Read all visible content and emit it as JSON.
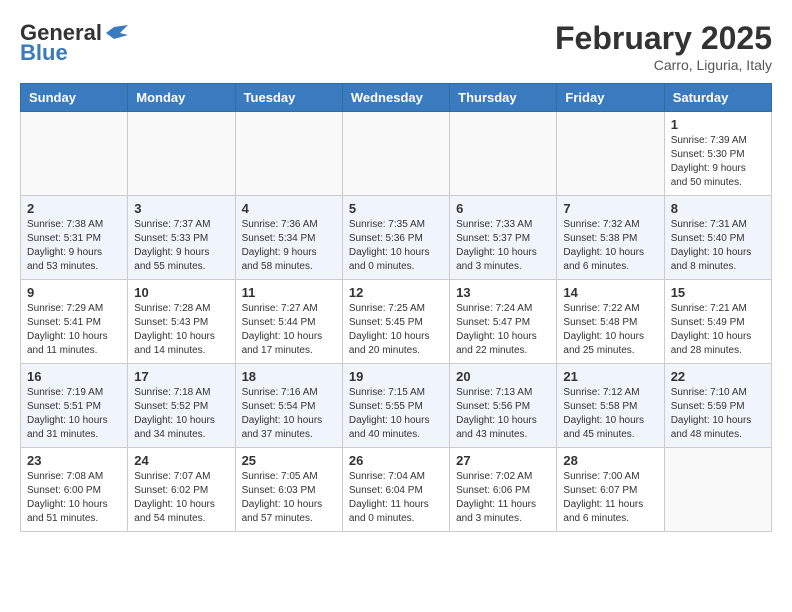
{
  "header": {
    "logo_general": "General",
    "logo_blue": "Blue",
    "month_title": "February 2025",
    "location": "Carro, Liguria, Italy"
  },
  "days_of_week": [
    "Sunday",
    "Monday",
    "Tuesday",
    "Wednesday",
    "Thursday",
    "Friday",
    "Saturday"
  ],
  "weeks": [
    [
      {
        "num": "",
        "info": ""
      },
      {
        "num": "",
        "info": ""
      },
      {
        "num": "",
        "info": ""
      },
      {
        "num": "",
        "info": ""
      },
      {
        "num": "",
        "info": ""
      },
      {
        "num": "",
        "info": ""
      },
      {
        "num": "1",
        "info": "Sunrise: 7:39 AM\nSunset: 5:30 PM\nDaylight: 9 hours and 50 minutes."
      }
    ],
    [
      {
        "num": "2",
        "info": "Sunrise: 7:38 AM\nSunset: 5:31 PM\nDaylight: 9 hours and 53 minutes."
      },
      {
        "num": "3",
        "info": "Sunrise: 7:37 AM\nSunset: 5:33 PM\nDaylight: 9 hours and 55 minutes."
      },
      {
        "num": "4",
        "info": "Sunrise: 7:36 AM\nSunset: 5:34 PM\nDaylight: 9 hours and 58 minutes."
      },
      {
        "num": "5",
        "info": "Sunrise: 7:35 AM\nSunset: 5:36 PM\nDaylight: 10 hours and 0 minutes."
      },
      {
        "num": "6",
        "info": "Sunrise: 7:33 AM\nSunset: 5:37 PM\nDaylight: 10 hours and 3 minutes."
      },
      {
        "num": "7",
        "info": "Sunrise: 7:32 AM\nSunset: 5:38 PM\nDaylight: 10 hours and 6 minutes."
      },
      {
        "num": "8",
        "info": "Sunrise: 7:31 AM\nSunset: 5:40 PM\nDaylight: 10 hours and 8 minutes."
      }
    ],
    [
      {
        "num": "9",
        "info": "Sunrise: 7:29 AM\nSunset: 5:41 PM\nDaylight: 10 hours and 11 minutes."
      },
      {
        "num": "10",
        "info": "Sunrise: 7:28 AM\nSunset: 5:43 PM\nDaylight: 10 hours and 14 minutes."
      },
      {
        "num": "11",
        "info": "Sunrise: 7:27 AM\nSunset: 5:44 PM\nDaylight: 10 hours and 17 minutes."
      },
      {
        "num": "12",
        "info": "Sunrise: 7:25 AM\nSunset: 5:45 PM\nDaylight: 10 hours and 20 minutes."
      },
      {
        "num": "13",
        "info": "Sunrise: 7:24 AM\nSunset: 5:47 PM\nDaylight: 10 hours and 22 minutes."
      },
      {
        "num": "14",
        "info": "Sunrise: 7:22 AM\nSunset: 5:48 PM\nDaylight: 10 hours and 25 minutes."
      },
      {
        "num": "15",
        "info": "Sunrise: 7:21 AM\nSunset: 5:49 PM\nDaylight: 10 hours and 28 minutes."
      }
    ],
    [
      {
        "num": "16",
        "info": "Sunrise: 7:19 AM\nSunset: 5:51 PM\nDaylight: 10 hours and 31 minutes."
      },
      {
        "num": "17",
        "info": "Sunrise: 7:18 AM\nSunset: 5:52 PM\nDaylight: 10 hours and 34 minutes."
      },
      {
        "num": "18",
        "info": "Sunrise: 7:16 AM\nSunset: 5:54 PM\nDaylight: 10 hours and 37 minutes."
      },
      {
        "num": "19",
        "info": "Sunrise: 7:15 AM\nSunset: 5:55 PM\nDaylight: 10 hours and 40 minutes."
      },
      {
        "num": "20",
        "info": "Sunrise: 7:13 AM\nSunset: 5:56 PM\nDaylight: 10 hours and 43 minutes."
      },
      {
        "num": "21",
        "info": "Sunrise: 7:12 AM\nSunset: 5:58 PM\nDaylight: 10 hours and 45 minutes."
      },
      {
        "num": "22",
        "info": "Sunrise: 7:10 AM\nSunset: 5:59 PM\nDaylight: 10 hours and 48 minutes."
      }
    ],
    [
      {
        "num": "23",
        "info": "Sunrise: 7:08 AM\nSunset: 6:00 PM\nDaylight: 10 hours and 51 minutes."
      },
      {
        "num": "24",
        "info": "Sunrise: 7:07 AM\nSunset: 6:02 PM\nDaylight: 10 hours and 54 minutes."
      },
      {
        "num": "25",
        "info": "Sunrise: 7:05 AM\nSunset: 6:03 PM\nDaylight: 10 hours and 57 minutes."
      },
      {
        "num": "26",
        "info": "Sunrise: 7:04 AM\nSunset: 6:04 PM\nDaylight: 11 hours and 0 minutes."
      },
      {
        "num": "27",
        "info": "Sunrise: 7:02 AM\nSunset: 6:06 PM\nDaylight: 11 hours and 3 minutes."
      },
      {
        "num": "28",
        "info": "Sunrise: 7:00 AM\nSunset: 6:07 PM\nDaylight: 11 hours and 6 minutes."
      },
      {
        "num": "",
        "info": ""
      }
    ]
  ]
}
